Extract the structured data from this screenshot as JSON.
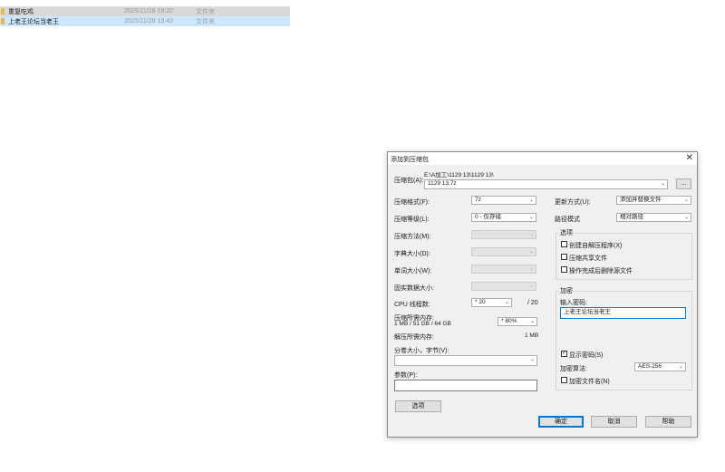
{
  "explorer": {
    "rows": [
      {
        "name": "重复吃鸡",
        "date": "2025/11/28 19:20",
        "type": "文件夹"
      },
      {
        "name": "上老王论坛当老王",
        "date": "2025/11/28 19:43",
        "type": "文件夹"
      }
    ]
  },
  "dialog": {
    "title": "添加到压缩包",
    "close_glyph": "✕",
    "archive_label": "压缩包(A):",
    "archive_path": "E:\\A加工\\1129 13\\1129 13\\",
    "archive_name": "1129 13.7z",
    "browse_label": "...",
    "left": {
      "format_label": "压缩格式(F):",
      "format_value": "7z",
      "level_label": "压缩等级(L):",
      "level_value": "0 - 仅存储",
      "method_label": "压缩方法(M):",
      "dict_label": "字典大小(D):",
      "word_label": "单词大小(W):",
      "solid_label": "固实数据大小:",
      "cpu_label": "CPU 线程数:",
      "cpu_value": "* 20",
      "cpu_max": "/ 20",
      "mem_label": "压缩所需内存:",
      "mem_detail": "1 MB / 51 GB / 64 GB",
      "mem_value": "* 80%",
      "decomp_label": "解压所需内存:",
      "decomp_value": "1 MB",
      "split_label": "分卷大小，字节(V):",
      "split_value": "",
      "params_label": "参数(P):",
      "params_value": "",
      "options_button": "选项"
    },
    "right": {
      "update_label": "更新方式(U):",
      "update_value": "添加并替换文件",
      "path_label": "路径模式",
      "path_value": "相对路径",
      "options_group": "选项",
      "opt_sfx": "创建自解压程序(X)",
      "opt_shared": "压缩共享文件",
      "opt_delete": "操作完成后删除源文件",
      "encrypt_group": "加密",
      "password_label": "输入密码:",
      "password_value": "上老王论坛当老王",
      "show_password": "显示密码(S)",
      "show_password_checked": "✓",
      "encrypt_method_label": "加密算法:",
      "encrypt_method_value": "AES-256",
      "encrypt_names": "加密文件名(N)"
    },
    "buttons": {
      "ok": "确定",
      "cancel": "取消",
      "help": "帮助"
    },
    "chevron": "⌄"
  }
}
